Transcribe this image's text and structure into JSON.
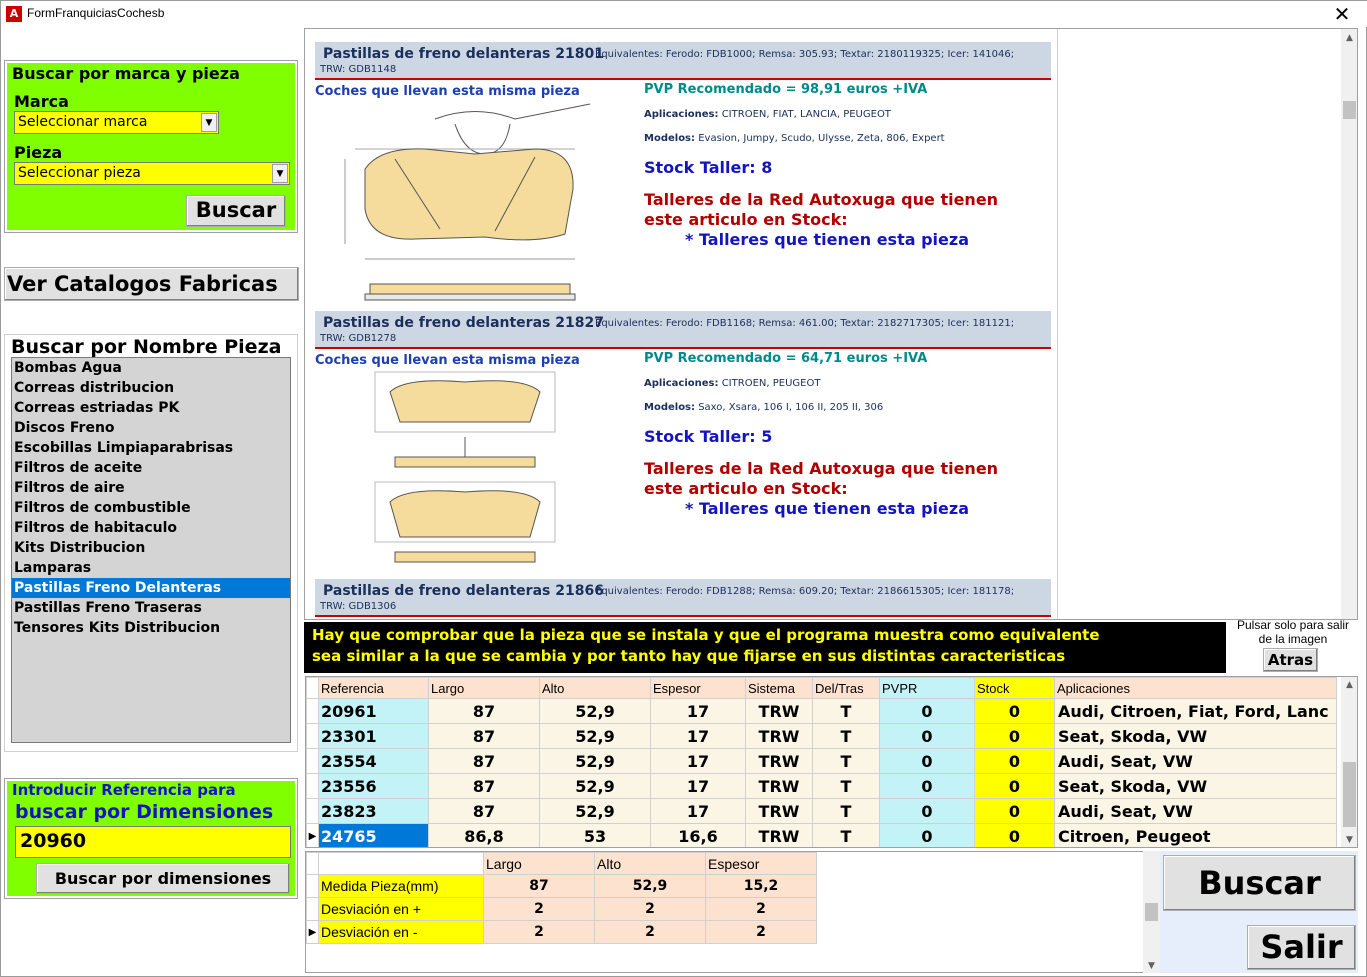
{
  "window": {
    "title": "FormFranquiciasCochesb",
    "icon_text": "A",
    "close_glyph": "✕"
  },
  "search_brand_part": {
    "group_title": "Buscar por marca y pieza",
    "marca_label": "Marca",
    "marca_value": "Seleccionar marca",
    "pieza_label": "Pieza",
    "pieza_value": "Seleccionar pieza",
    "search_button": "Buscar"
  },
  "catalog_button": "Ver Catalogos Fabricas",
  "name_search": {
    "title": "Buscar por Nombre Pieza",
    "items": [
      "Bombas Agua",
      "Correas distribucion",
      "Correas estriadas PK",
      "Discos Freno",
      "Escobillas Limpiaparabrisas",
      "Filtros de aceite",
      "Filtros de aire",
      "Filtros de combustible",
      "Filtros de habitaculo",
      "Kits Distribucion",
      "Lamparas",
      "Pastillas Freno Delanteras",
      "Pastillas Freno Traseras",
      "Tensores Kits Distribucion"
    ],
    "selected_index": 11
  },
  "dimension_search": {
    "title_line1": "Introducir Referencia para",
    "title_line2": "buscar por Dimensiones",
    "reference_value": "20960",
    "button": "Buscar por dimensiones"
  },
  "cards": [
    {
      "title": "Pastillas de freno delanteras 21801",
      "equivalents": "Equivalentes: Ferodo: FDB1000; Remsa: 305.93; Textar: 2180119325; Icer: 141046;",
      "equivalents2": "TRW: GDB1148",
      "coches": "Coches que llevan esta misma pieza",
      "pvp": "PVP Recomendado = 98,91 euros +IVA",
      "aplicaciones_label": "Aplicaciones:",
      "aplicaciones": "CITROEN, FIAT, LANCIA, PEUGEOT",
      "modelos_label": "Modelos:",
      "modelos": "Evasion, Jumpy, Scudo, Ulysse, Zeta, 806, Expert",
      "stock": "Stock Taller: 8",
      "red_line1": "Talleres de la Red Autoxuga que tienen",
      "red_line2": "este articulo en Stock:",
      "talleres_link": "* Talleres que tienen esta pieza"
    },
    {
      "title": "Pastillas de freno delanteras 21827",
      "equivalents": "Equivalentes: Ferodo: FDB1168; Remsa: 461.00; Textar: 2182717305; Icer: 181121;",
      "equivalents2": "TRW: GDB1278",
      "coches": "Coches que llevan esta misma pieza",
      "pvp": "PVP Recomendado = 64,71 euros +IVA",
      "aplicaciones_label": "Aplicaciones:",
      "aplicaciones": "CITROEN, PEUGEOT",
      "modelos_label": "Modelos:",
      "modelos": "Saxo, Xsara, 106 I, 106 II, 205 II, 306",
      "stock": "Stock Taller: 5",
      "red_line1": "Talleres de la Red Autoxuga que tienen",
      "red_line2": "este articulo en Stock:",
      "talleres_link": "* Talleres que tienen esta pieza"
    },
    {
      "title": "Pastillas de freno delanteras 21866",
      "equivalents": "Equivalentes: Ferodo: FDB1288; Remsa: 609.20; Textar: 2186615305; Icer: 181178;",
      "equivalents2": "TRW: GDB1306"
    }
  ],
  "warning": {
    "line1": "Hay que comprobar que la pieza que se instala y que el programa muestra como equivalente",
    "line2": "sea similar a la que se cambia y por tanto hay que fijarse en sus distintas caracteristicas"
  },
  "exit_image": {
    "hint": "Pulsar solo para salir de la imagen",
    "button": "Atras"
  },
  "results_grid": {
    "headers": [
      "Referencia",
      "Largo",
      "Alto",
      "Espesor",
      "Sistema",
      "Del/Tras",
      "PVPR",
      "Stock",
      "Aplicaciones"
    ],
    "rows": [
      [
        "20961",
        "87",
        "52,9",
        "17",
        "TRW",
        "T",
        "0",
        "0",
        "Audi, Citroen, Fiat, Ford, Lanc"
      ],
      [
        "23301",
        "87",
        "52,9",
        "17",
        "TRW",
        "T",
        "0",
        "0",
        "Seat, Skoda, VW"
      ],
      [
        "23554",
        "87",
        "52,9",
        "17",
        "TRW",
        "T",
        "0",
        "0",
        "Audi, Seat, VW"
      ],
      [
        "23556",
        "87",
        "52,9",
        "17",
        "TRW",
        "T",
        "0",
        "0",
        "Seat, Skoda, VW"
      ],
      [
        "23823",
        "87",
        "52,9",
        "17",
        "TRW",
        "T",
        "0",
        "0",
        "Audi, Seat, VW"
      ],
      [
        "24765",
        "86,8",
        "53",
        "16,6",
        "TRW",
        "T",
        "0",
        "0",
        "Citroen, Peugeot"
      ]
    ],
    "selected_row": 5,
    "row_indicator": "▶"
  },
  "dimensions_grid": {
    "headers": [
      "Largo",
      "Alto",
      "Espesor"
    ],
    "rows": [
      {
        "label": "Medida Pieza(mm)",
        "values": [
          "87",
          "52,9",
          "15,2"
        ]
      },
      {
        "label": "Desviación en +",
        "values": [
          "2",
          "2",
          "2"
        ]
      },
      {
        "label": "Desviación en -",
        "values": [
          "2",
          "2",
          "2"
        ]
      }
    ]
  },
  "actions": {
    "buscar": "Buscar",
    "salir": "Salir"
  }
}
